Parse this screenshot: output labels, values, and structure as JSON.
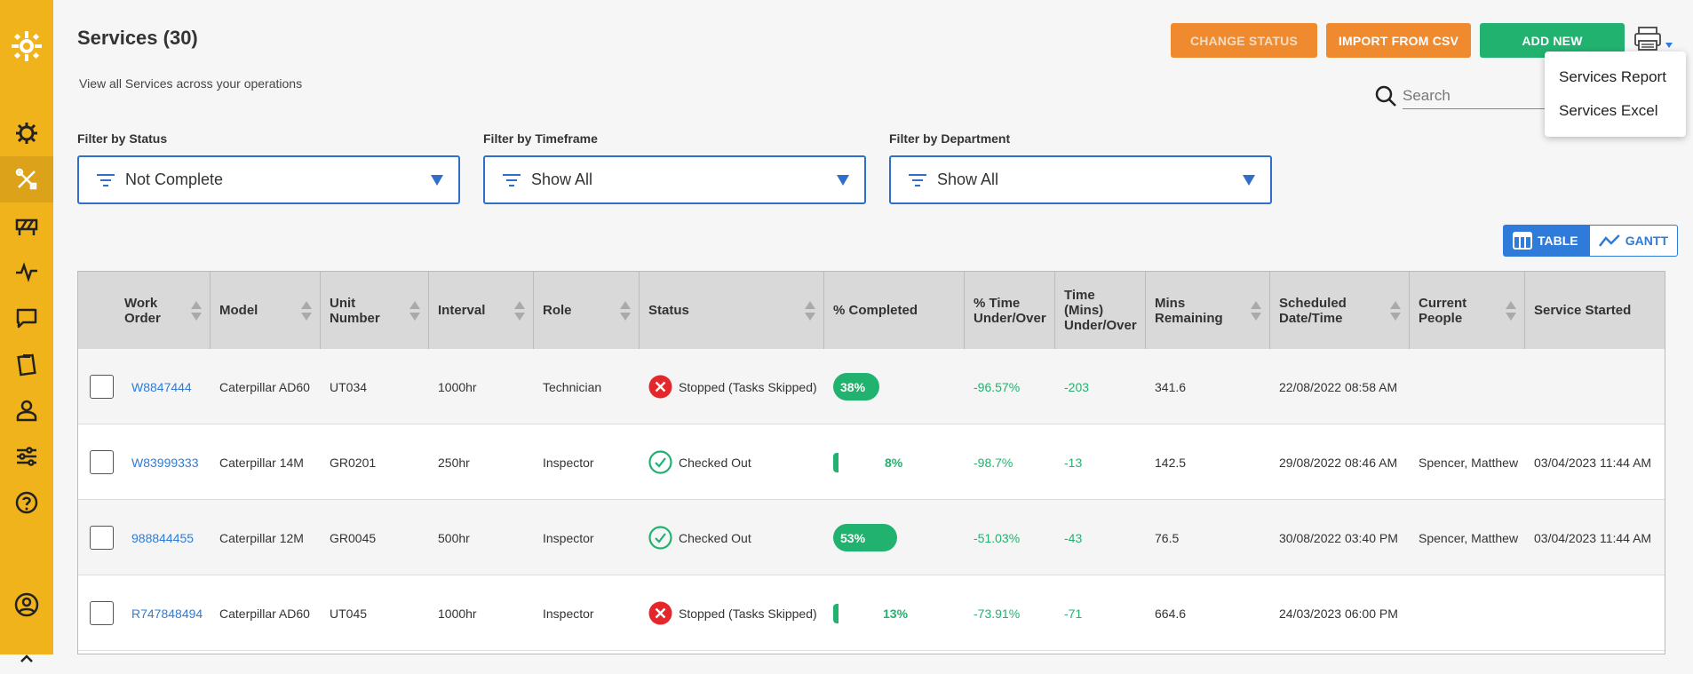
{
  "page": {
    "title": "Services (30)",
    "subtitle": "View all Services across your operations"
  },
  "toolbar": {
    "change_status": "CHANGE STATUS",
    "import_csv": "IMPORT FROM CSV",
    "add_new": "ADD NEW"
  },
  "search": {
    "placeholder": "Search"
  },
  "print_menu": {
    "items": [
      "Services Report",
      "Services Excel"
    ]
  },
  "filters": [
    {
      "label": "Filter by Status",
      "value": "Not Complete"
    },
    {
      "label": "Filter by Timeframe",
      "value": "Show All"
    },
    {
      "label": "Filter by Department",
      "value": "Show All"
    }
  ],
  "view_toggle": {
    "table": "TABLE",
    "gantt": "GANTT"
  },
  "table": {
    "columns": [
      {
        "l1": "Work",
        "l2": "Order"
      },
      {
        "l1": "Model",
        "l2": ""
      },
      {
        "l1": "Unit",
        "l2": "Number"
      },
      {
        "l1": "Interval",
        "l2": ""
      },
      {
        "l1": "Role",
        "l2": ""
      },
      {
        "l1": "Status",
        "l2": ""
      },
      {
        "l1": "% Completed",
        "l2": ""
      },
      {
        "l1": "% Time",
        "l2": "Under/Over"
      },
      {
        "l1": "Time",
        "l2": "(Mins)",
        "l3": "Under/Over"
      },
      {
        "l1": "Mins",
        "l2": "Remaining"
      },
      {
        "l1": "Scheduled",
        "l2": "Date/Time"
      },
      {
        "l1": "Current",
        "l2": "People"
      },
      {
        "l1": "Service Started",
        "l2": ""
      }
    ],
    "rows": [
      {
        "work_order": "W8847444",
        "model": "Caterpillar AD60",
        "unit": "UT034",
        "interval": "1000hr",
        "role": "Technician",
        "status": "Stopped (Tasks Skipped)",
        "status_type": "stopped",
        "pct": "38%",
        "pct_value": 38,
        "time_pct": "-96.57%",
        "time_mins": "-203",
        "mins_remaining": "341.6",
        "scheduled": "22/08/2022 08:58 AM",
        "people": "",
        "started": ""
      },
      {
        "work_order": "W83999333",
        "model": "Caterpillar 14M",
        "unit": "GR0201",
        "interval": "250hr",
        "role": "Inspector",
        "status": "Checked Out",
        "status_type": "checked",
        "pct": "8%",
        "pct_value": 8,
        "time_pct": "-98.7%",
        "time_mins": "-13",
        "mins_remaining": "142.5",
        "scheduled": "29/08/2022 08:46 AM",
        "people": "Spencer, Matthew",
        "started": "03/04/2023 11:44 AM"
      },
      {
        "work_order": "988844455",
        "model": "Caterpillar 12M",
        "unit": "GR0045",
        "interval": "500hr",
        "role": "Inspector",
        "status": "Checked Out",
        "status_type": "checked",
        "pct": "53%",
        "pct_value": 53,
        "time_pct": "-51.03%",
        "time_mins": "-43",
        "mins_remaining": "76.5",
        "scheduled": "30/08/2022 03:40 PM",
        "people": "Spencer, Matthew",
        "started": "03/04/2023 11:44 AM"
      },
      {
        "work_order": "R747848494",
        "model": "Caterpillar AD60",
        "unit": "UT045",
        "interval": "1000hr",
        "role": "Inspector",
        "status": "Stopped (Tasks Skipped)",
        "status_type": "stopped",
        "pct": "13%",
        "pct_value": 13,
        "time_pct": "-73.91%",
        "time_mins": "-71",
        "mins_remaining": "664.6",
        "scheduled": "24/03/2023 06:00 PM",
        "people": "",
        "started": ""
      }
    ]
  },
  "colors": {
    "sidebar": "#f0b31c",
    "accent_blue": "#2f7bd9",
    "green": "#22b26f",
    "orange": "#f08a2e",
    "red": "#e5262a"
  }
}
